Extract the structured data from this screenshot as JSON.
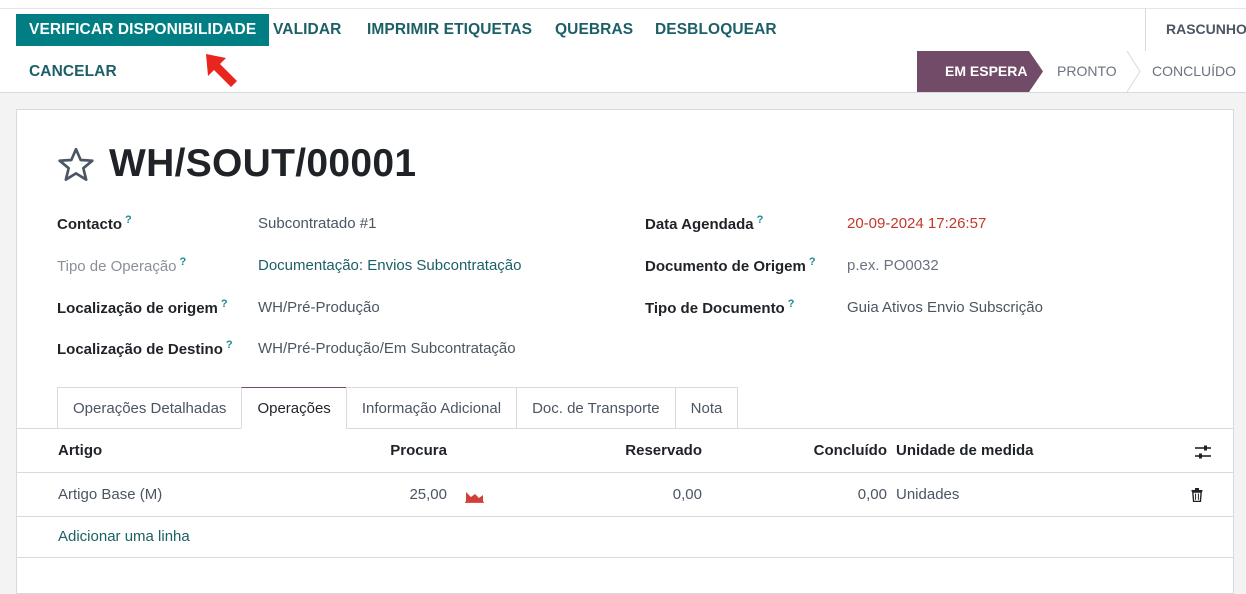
{
  "actions": {
    "check_availability": "VERIFICAR DISPONIBILIDADE",
    "validate": "VALIDAR",
    "print_labels": "IMPRIMIR ETIQUETAS",
    "scrap": "QUEBRAS",
    "unlock": "DESBLOQUEAR",
    "cancel": "CANCELAR"
  },
  "statusbar": {
    "draft": "RASCUNHO",
    "waiting": "EM ESPERA",
    "ready": "PRONTO",
    "done": "CONCLUÍDO",
    "active_color": "#714b67"
  },
  "record": {
    "title": "WH/SOUT/00001",
    "fields_left": [
      {
        "label": "Contacto",
        "value": "Subcontratado #1"
      },
      {
        "label": "Tipo de Operação",
        "value": "Documentação: Envios Subcontratação"
      },
      {
        "label": "Localização de origem",
        "value": "WH/Pré-Produção"
      },
      {
        "label": "Localização de Destino",
        "value": "WH/Pré-Produção/Em Subcontratação"
      }
    ],
    "fields_right": [
      {
        "label": "Data Agendada",
        "value": "20-09-2024 17:26:57"
      },
      {
        "label": "Documento de Origem",
        "value": "p.ex. PO0032"
      },
      {
        "label": "Tipo de Documento",
        "value": "Guia Ativos Envio Subscrição"
      }
    ],
    "help_mark": "?"
  },
  "tabs": [
    "Operações Detalhadas",
    "Operações",
    "Informação Adicional",
    "Doc. de Transporte",
    "Nota"
  ],
  "table": {
    "headers": {
      "product": "Artigo",
      "demand": "Procura",
      "reserved": "Reservado",
      "done": "Concluído",
      "uom": "Unidade de medida"
    },
    "rows": [
      {
        "product": "Artigo Base (M)",
        "demand": "25,00",
        "reserved": "0,00",
        "done": "0,00",
        "uom": "Unidades"
      }
    ],
    "add_line": "Adicionar uma linha"
  },
  "icons": {
    "favorite": "star-icon",
    "forecast": "area-chart-icon",
    "column_settings": "sliders-icon",
    "delete": "trash-icon",
    "annotation": "red-arrow-icon"
  },
  "colors": {
    "primary": "#017e84",
    "link": "#1c5f66",
    "date_red": "#c0392b",
    "forecast_red": "#d23f3a"
  }
}
